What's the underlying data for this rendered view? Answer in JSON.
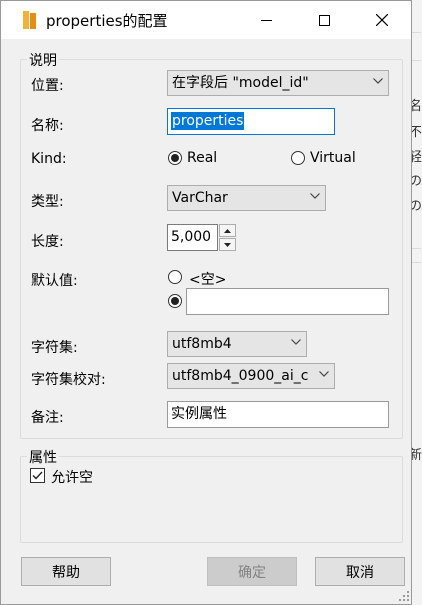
{
  "window": {
    "title": "properties的配置"
  },
  "description_group": {
    "title": "说明",
    "position_label": "位置:",
    "position_value": "在字段后 \"model_id\"",
    "name_label": "名称:",
    "name_value": "properties",
    "kind_label": "Kind:",
    "kind_options": [
      "Real",
      "Virtual"
    ],
    "kind_selected": "Real",
    "type_label": "类型:",
    "type_value": "VarChar",
    "length_label": "长度:",
    "length_value": "5,000",
    "default_label": "默认值:",
    "default_empty_option": "<空>",
    "default_custom_value": "",
    "charset_label": "字符集:",
    "charset_value": "utf8mb4",
    "collation_label": "字符集校对:",
    "collation_value": "utf8mb4_0900_ai_c",
    "comment_label": "备注:",
    "comment_value": "实例属性"
  },
  "attributes_group": {
    "title": "属性",
    "allow_null_label": "允许空",
    "allow_null_checked": true
  },
  "buttons": {
    "help": "帮助",
    "ok": "确定",
    "cancel": "取消"
  },
  "background_window": {
    "glyphs": [
      "名",
      "不",
      "轻",
      "の",
      "の",
      "|",
      "新"
    ]
  },
  "colors": {
    "selection": "#0078d7",
    "accent_icon": "#f3b233"
  }
}
